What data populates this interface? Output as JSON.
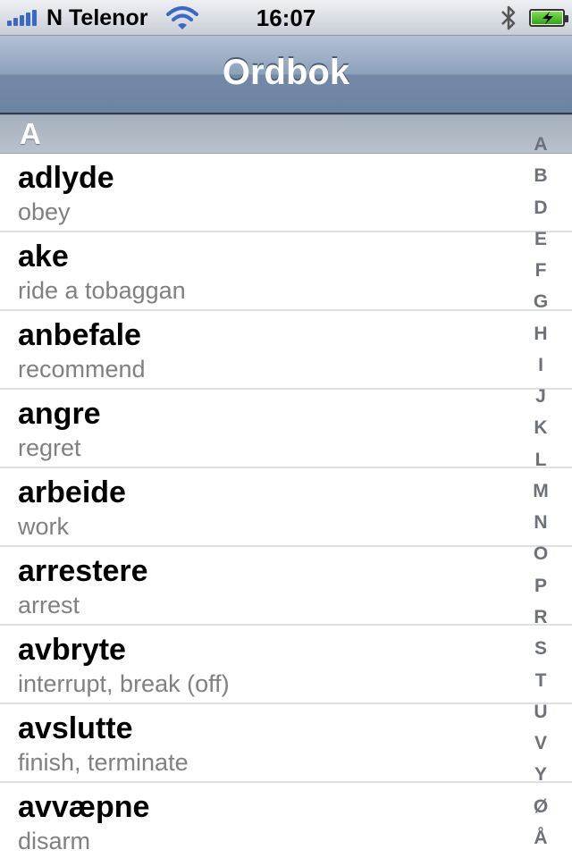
{
  "status_bar": {
    "carrier": "N Telenor",
    "time": "16:07",
    "signal_icon": "signal-bars-icon",
    "wifi_icon": "wifi-icon",
    "bluetooth_icon": "bluetooth-icon",
    "battery_icon": "battery-charging-icon"
  },
  "nav": {
    "title": "Ordbok"
  },
  "section": {
    "title": "A"
  },
  "entries": [
    {
      "word": "adlyde",
      "meaning": "obey"
    },
    {
      "word": "ake",
      "meaning": "ride a tobaggan"
    },
    {
      "word": "anbefale",
      "meaning": "recommend"
    },
    {
      "word": "angre",
      "meaning": "regret"
    },
    {
      "word": "arbeide",
      "meaning": "work"
    },
    {
      "word": "arrestere",
      "meaning": "arrest"
    },
    {
      "word": "avbryte",
      "meaning": "interrupt, break (off)"
    },
    {
      "word": "avslutte",
      "meaning": "finish, terminate"
    },
    {
      "word": "avvæpne",
      "meaning": "disarm"
    }
  ],
  "index": [
    "A",
    "B",
    "D",
    "E",
    "F",
    "G",
    "H",
    "I",
    "J",
    "K",
    "L",
    "M",
    "N",
    "O",
    "P",
    "R",
    "S",
    "T",
    "U",
    "V",
    "Y",
    "Ø",
    "Å"
  ],
  "colors": {
    "nav_bar": "#7489a7",
    "section_header": "#aab5c1",
    "signal": "#3a68c7",
    "battery": "#2fa51a"
  }
}
